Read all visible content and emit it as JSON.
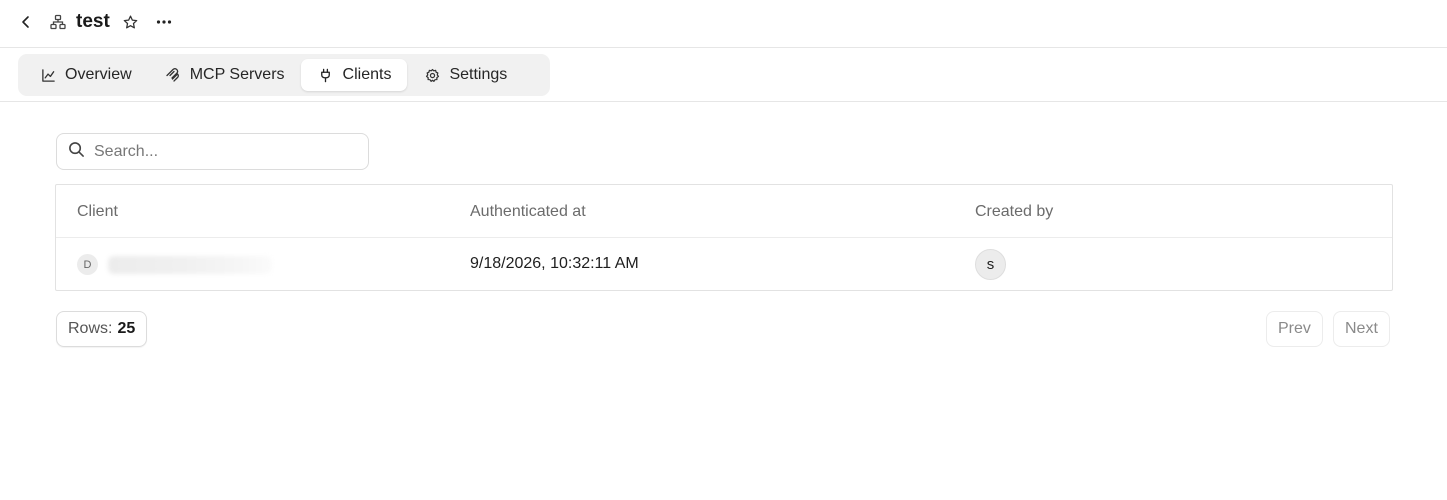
{
  "header": {
    "title": "test",
    "icons": {
      "back": "chevron-left-icon",
      "project": "network-icon",
      "star": "star-icon",
      "more": "more-horizontal-icon"
    }
  },
  "tabs": [
    {
      "label": "Overview",
      "icon": "chart-line-icon",
      "active": false
    },
    {
      "label": "MCP Servers",
      "icon": "mcp-icon",
      "active": false
    },
    {
      "label": "Clients",
      "icon": "plug-icon",
      "active": true
    },
    {
      "label": "Settings",
      "icon": "gear-icon",
      "active": false
    }
  ],
  "search": {
    "placeholder": "Search...",
    "value": ""
  },
  "table": {
    "columns": [
      "Client",
      "Authenticated at",
      "Created by"
    ],
    "rows": [
      {
        "client_initial": "D",
        "authenticated_at": "9/18/2026, 10:32:11 AM",
        "created_by_initial": "s"
      }
    ]
  },
  "pagination": {
    "rows_label": "Rows:",
    "rows_value": "25",
    "prev": "Prev",
    "next": "Next"
  },
  "colors": {
    "tab_bg": "#f1f1f1",
    "border": "#e2e2e2",
    "muted_text": "#6b6b6b"
  }
}
